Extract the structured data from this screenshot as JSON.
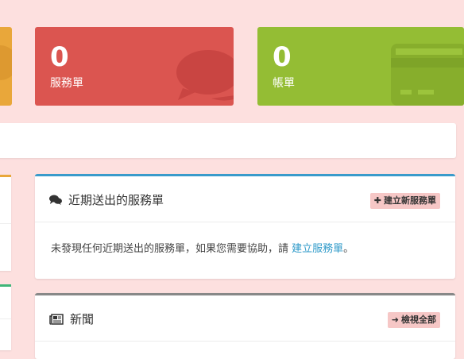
{
  "tiles": {
    "tickets": {
      "count": "0",
      "label": "服務單",
      "icon": "comments-icon"
    },
    "invoices": {
      "count": "0",
      "label": "帳單",
      "icon": "credit-card-icon"
    }
  },
  "recent_tickets": {
    "title": "近期送出的服務單",
    "icon": "comments-icon",
    "button_label": "建立新服務單",
    "body_text": "未發現任何近期送出的服務單，如果您需要協助，請",
    "body_link": "建立服務單",
    "body_end": "。"
  },
  "news": {
    "title": "新聞",
    "icon": "newspaper-icon",
    "button_label": "檢視全部"
  },
  "colors": {
    "page_bg": "#fde0df",
    "tickets_tile": "#db5550",
    "invoices_tile": "#94bd34",
    "orange_tile": "#e9a73a",
    "recent_accent": "#3a9bcb",
    "news_accent": "#888888",
    "link": "#2f9ac9"
  }
}
